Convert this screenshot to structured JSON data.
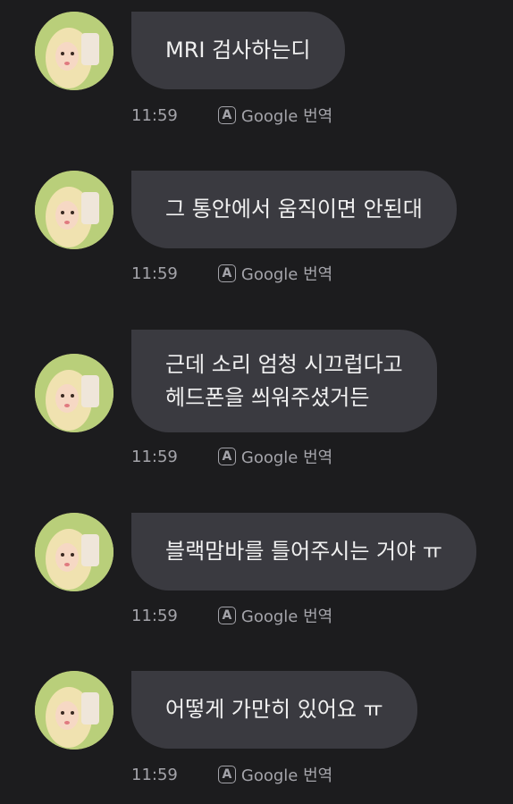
{
  "messages": [
    {
      "lines": [
        "MRI 검사하는디"
      ],
      "time": "11:59",
      "translate": "Google 번역"
    },
    {
      "lines": [
        "그 통안에서 움직이면 안된대"
      ],
      "time": "11:59",
      "translate": "Google 번역"
    },
    {
      "lines": [
        "근데 소리 엄청 시끄럽다고",
        "헤드폰을 씌워주셨거든"
      ],
      "time": "11:59",
      "translate": "Google 번역"
    },
    {
      "lines": [
        "블랙맘바를 틀어주시는 거야 ㅠ"
      ],
      "time": "11:59",
      "translate": "Google 번역"
    },
    {
      "lines": [
        "어떻게 가만히 있어요 ㅠ"
      ],
      "time": "11:59",
      "translate": "Google 번역"
    }
  ],
  "translate_icon_letter": "A",
  "colors": {
    "background": "#1c1c1e",
    "bubble": "#3a3a40",
    "meta_text": "#a4a4aa"
  }
}
